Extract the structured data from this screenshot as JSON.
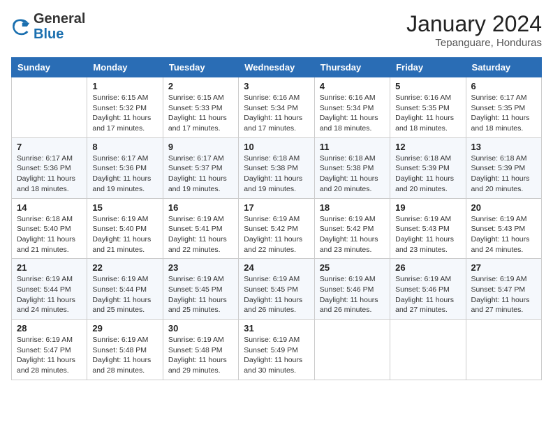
{
  "logo": {
    "general": "General",
    "blue": "Blue"
  },
  "title": "January 2024",
  "location": "Tepanguare, Honduras",
  "headers": [
    "Sunday",
    "Monday",
    "Tuesday",
    "Wednesday",
    "Thursday",
    "Friday",
    "Saturday"
  ],
  "weeks": [
    [
      {
        "day": "",
        "info": ""
      },
      {
        "day": "1",
        "info": "Sunrise: 6:15 AM\nSunset: 5:32 PM\nDaylight: 11 hours\nand 17 minutes."
      },
      {
        "day": "2",
        "info": "Sunrise: 6:15 AM\nSunset: 5:33 PM\nDaylight: 11 hours\nand 17 minutes."
      },
      {
        "day": "3",
        "info": "Sunrise: 6:16 AM\nSunset: 5:34 PM\nDaylight: 11 hours\nand 17 minutes."
      },
      {
        "day": "4",
        "info": "Sunrise: 6:16 AM\nSunset: 5:34 PM\nDaylight: 11 hours\nand 18 minutes."
      },
      {
        "day": "5",
        "info": "Sunrise: 6:16 AM\nSunset: 5:35 PM\nDaylight: 11 hours\nand 18 minutes."
      },
      {
        "day": "6",
        "info": "Sunrise: 6:17 AM\nSunset: 5:35 PM\nDaylight: 11 hours\nand 18 minutes."
      }
    ],
    [
      {
        "day": "7",
        "info": "Sunrise: 6:17 AM\nSunset: 5:36 PM\nDaylight: 11 hours\nand 18 minutes."
      },
      {
        "day": "8",
        "info": "Sunrise: 6:17 AM\nSunset: 5:36 PM\nDaylight: 11 hours\nand 19 minutes."
      },
      {
        "day": "9",
        "info": "Sunrise: 6:17 AM\nSunset: 5:37 PM\nDaylight: 11 hours\nand 19 minutes."
      },
      {
        "day": "10",
        "info": "Sunrise: 6:18 AM\nSunset: 5:38 PM\nDaylight: 11 hours\nand 19 minutes."
      },
      {
        "day": "11",
        "info": "Sunrise: 6:18 AM\nSunset: 5:38 PM\nDaylight: 11 hours\nand 20 minutes."
      },
      {
        "day": "12",
        "info": "Sunrise: 6:18 AM\nSunset: 5:39 PM\nDaylight: 11 hours\nand 20 minutes."
      },
      {
        "day": "13",
        "info": "Sunrise: 6:18 AM\nSunset: 5:39 PM\nDaylight: 11 hours\nand 20 minutes."
      }
    ],
    [
      {
        "day": "14",
        "info": "Sunrise: 6:18 AM\nSunset: 5:40 PM\nDaylight: 11 hours\nand 21 minutes."
      },
      {
        "day": "15",
        "info": "Sunrise: 6:19 AM\nSunset: 5:40 PM\nDaylight: 11 hours\nand 21 minutes."
      },
      {
        "day": "16",
        "info": "Sunrise: 6:19 AM\nSunset: 5:41 PM\nDaylight: 11 hours\nand 22 minutes."
      },
      {
        "day": "17",
        "info": "Sunrise: 6:19 AM\nSunset: 5:42 PM\nDaylight: 11 hours\nand 22 minutes."
      },
      {
        "day": "18",
        "info": "Sunrise: 6:19 AM\nSunset: 5:42 PM\nDaylight: 11 hours\nand 23 minutes."
      },
      {
        "day": "19",
        "info": "Sunrise: 6:19 AM\nSunset: 5:43 PM\nDaylight: 11 hours\nand 23 minutes."
      },
      {
        "day": "20",
        "info": "Sunrise: 6:19 AM\nSunset: 5:43 PM\nDaylight: 11 hours\nand 24 minutes."
      }
    ],
    [
      {
        "day": "21",
        "info": "Sunrise: 6:19 AM\nSunset: 5:44 PM\nDaylight: 11 hours\nand 24 minutes."
      },
      {
        "day": "22",
        "info": "Sunrise: 6:19 AM\nSunset: 5:44 PM\nDaylight: 11 hours\nand 25 minutes."
      },
      {
        "day": "23",
        "info": "Sunrise: 6:19 AM\nSunset: 5:45 PM\nDaylight: 11 hours\nand 25 minutes."
      },
      {
        "day": "24",
        "info": "Sunrise: 6:19 AM\nSunset: 5:45 PM\nDaylight: 11 hours\nand 26 minutes."
      },
      {
        "day": "25",
        "info": "Sunrise: 6:19 AM\nSunset: 5:46 PM\nDaylight: 11 hours\nand 26 minutes."
      },
      {
        "day": "26",
        "info": "Sunrise: 6:19 AM\nSunset: 5:46 PM\nDaylight: 11 hours\nand 27 minutes."
      },
      {
        "day": "27",
        "info": "Sunrise: 6:19 AM\nSunset: 5:47 PM\nDaylight: 11 hours\nand 27 minutes."
      }
    ],
    [
      {
        "day": "28",
        "info": "Sunrise: 6:19 AM\nSunset: 5:47 PM\nDaylight: 11 hours\nand 28 minutes."
      },
      {
        "day": "29",
        "info": "Sunrise: 6:19 AM\nSunset: 5:48 PM\nDaylight: 11 hours\nand 28 minutes."
      },
      {
        "day": "30",
        "info": "Sunrise: 6:19 AM\nSunset: 5:48 PM\nDaylight: 11 hours\nand 29 minutes."
      },
      {
        "day": "31",
        "info": "Sunrise: 6:19 AM\nSunset: 5:49 PM\nDaylight: 11 hours\nand 30 minutes."
      },
      {
        "day": "",
        "info": ""
      },
      {
        "day": "",
        "info": ""
      },
      {
        "day": "",
        "info": ""
      }
    ]
  ]
}
